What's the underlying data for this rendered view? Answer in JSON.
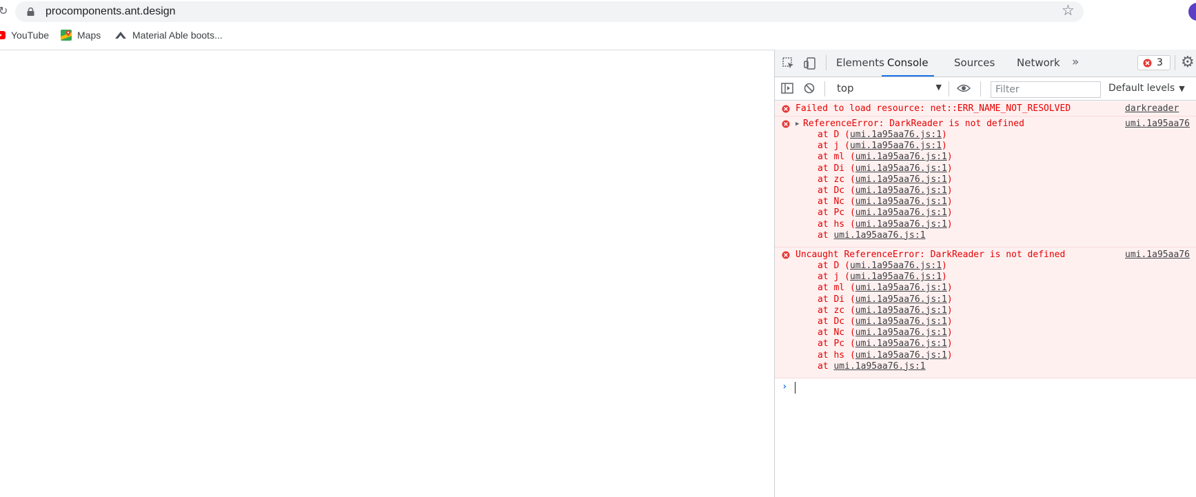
{
  "browser": {
    "url": "procomponents.ant.design",
    "bookmarks": [
      {
        "label": "YouTube",
        "icon": "youtube-icon"
      },
      {
        "label": "Maps",
        "icon": "maps-icon"
      },
      {
        "label": "Material Able boots...",
        "icon": "material-able-icon"
      }
    ]
  },
  "devtools": {
    "tabs": [
      "Elements",
      "Console",
      "Sources",
      "Network"
    ],
    "active_tab": "Console",
    "error_count": "3",
    "context": "top",
    "filter_placeholder": "Filter",
    "levels_label": "Default levels",
    "messages": [
      {
        "text": "Failed to load resource: net::ERR_NAME_NOT_RESOLVED",
        "source": "darkreader"
      },
      {
        "text": "ReferenceError: DarkReader is not defined",
        "source": "umi.1a95aa76",
        "stack": [
          {
            "fn": "D",
            "loc": "umi.1a95aa76.js:1"
          },
          {
            "fn": "j",
            "loc": "umi.1a95aa76.js:1"
          },
          {
            "fn": "ml",
            "loc": "umi.1a95aa76.js:1"
          },
          {
            "fn": "Di",
            "loc": "umi.1a95aa76.js:1"
          },
          {
            "fn": "zc",
            "loc": "umi.1a95aa76.js:1"
          },
          {
            "fn": "Dc",
            "loc": "umi.1a95aa76.js:1"
          },
          {
            "fn": "Nc",
            "loc": "umi.1a95aa76.js:1"
          },
          {
            "fn": "Pc",
            "loc": "umi.1a95aa76.js:1"
          },
          {
            "fn": "hs",
            "loc": "umi.1a95aa76.js:1"
          },
          {
            "fn": "",
            "loc": "umi.1a95aa76.js:1"
          }
        ]
      },
      {
        "text": "Uncaught ReferenceError: DarkReader is not defined",
        "source": "umi.1a95aa76",
        "stack": [
          {
            "fn": "D",
            "loc": "umi.1a95aa76.js:1"
          },
          {
            "fn": "j",
            "loc": "umi.1a95aa76.js:1"
          },
          {
            "fn": "ml",
            "loc": "umi.1a95aa76.js:1"
          },
          {
            "fn": "Di",
            "loc": "umi.1a95aa76.js:1"
          },
          {
            "fn": "zc",
            "loc": "umi.1a95aa76.js:1"
          },
          {
            "fn": "Dc",
            "loc": "umi.1a95aa76.js:1"
          },
          {
            "fn": "Nc",
            "loc": "umi.1a95aa76.js:1"
          },
          {
            "fn": "Pc",
            "loc": "umi.1a95aa76.js:1"
          },
          {
            "fn": "hs",
            "loc": "umi.1a95aa76.js:1"
          },
          {
            "fn": "",
            "loc": "umi.1a95aa76.js:1"
          }
        ]
      }
    ],
    "colors": {
      "error_text": "#e50000",
      "error_bg": "#fff0f0",
      "accent": "#1a73e8"
    }
  }
}
